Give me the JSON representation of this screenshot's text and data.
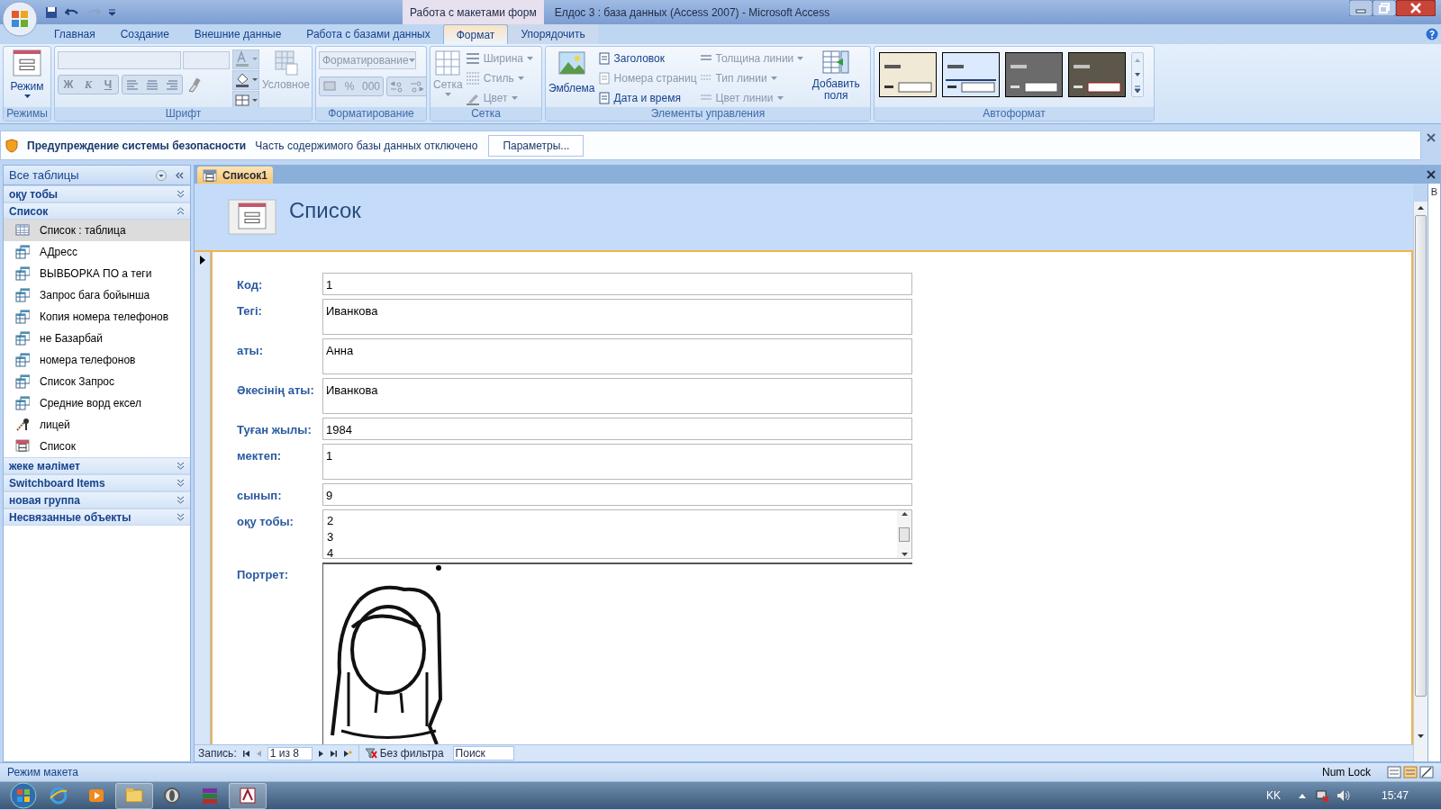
{
  "window": {
    "context": "Работа с макетами форм",
    "title": "Елдос 3 : база данных (Access 2007)  -  Microsoft Access"
  },
  "ribbon_tabs": [
    {
      "label": "Главная",
      "selected": false
    },
    {
      "label": "Создание",
      "selected": false
    },
    {
      "label": "Внешние данные",
      "selected": false
    },
    {
      "label": "Работа с базами данных",
      "selected": false
    },
    {
      "label": "Формат",
      "selected": true
    },
    {
      "label": "Упорядочить",
      "selected": false
    }
  ],
  "ribbon": {
    "modes": {
      "button": "Режим",
      "group": "Режимы"
    },
    "font": {
      "styles": [
        "Ж",
        "К",
        "Ч"
      ],
      "conditional": "Условное",
      "group": "Шрифт"
    },
    "formatting": {
      "dropdown": "Форматирование",
      "percent": "%",
      "thousands": "000",
      "group": "Форматирование"
    },
    "grid": {
      "button": "Сетка",
      "items": [
        {
          "label": "Ширина",
          "disabled": true
        },
        {
          "label": "Стиль",
          "disabled": true
        },
        {
          "label": "Цвет",
          "disabled": true
        }
      ],
      "group": "Сетка"
    },
    "controls": {
      "logo": "Эмблема",
      "items": [
        {
          "label": "Заголовок",
          "disabled": false
        },
        {
          "label": "Номера страниц",
          "disabled": true
        },
        {
          "label": "Дата и время",
          "disabled": false
        },
        {
          "label": "Толщина линии",
          "disabled": true
        },
        {
          "label": "Тип линии",
          "disabled": true
        },
        {
          "label": "Цвет линии",
          "disabled": true
        }
      ],
      "add_fields": "Добавить поля",
      "group": "Элементы управления"
    },
    "autoformat": {
      "styles": [
        {
          "color": "#efe9d6",
          "selected": false
        },
        {
          "color": "#dbeafe",
          "selected": false
        },
        {
          "color": "#6b6b6b",
          "selected": false
        },
        {
          "color": "#5c574a",
          "selected": false
        }
      ],
      "group": "Автоформат"
    }
  },
  "security_bar": {
    "title": "Предупреждение системы безопасности",
    "message": "Часть содержимого базы данных отключено",
    "button": "Параметры..."
  },
  "nav": {
    "title": "Все таблицы",
    "groups": [
      {
        "label": "оқу тобы",
        "expanded": false
      },
      {
        "label": "Список",
        "expanded": true,
        "items": [
          {
            "label": "Список : таблица",
            "kind": "table",
            "selected": true
          },
          {
            "label": "АДресс",
            "kind": "query",
            "selected": false
          },
          {
            "label": "ВЫВБОРКА  ПО а теги",
            "kind": "query",
            "selected": false
          },
          {
            "label": "Запрос бага бойынша",
            "kind": "query",
            "selected": false
          },
          {
            "label": "Копия номера телефонов",
            "kind": "query",
            "selected": false
          },
          {
            "label": "не Базарбай",
            "kind": "query",
            "selected": false
          },
          {
            "label": "номера телефонов",
            "kind": "query",
            "selected": false
          },
          {
            "label": "Список Запрос",
            "kind": "query",
            "selected": false
          },
          {
            "label": "Средние ворд ексел",
            "kind": "query",
            "selected": false
          },
          {
            "label": "лицей",
            "kind": "macro",
            "selected": false
          },
          {
            "label": "Список",
            "kind": "form",
            "selected": false
          }
        ]
      },
      {
        "label": "жеке мәлімет",
        "expanded": false
      },
      {
        "label": "Switchboard Items",
        "expanded": false
      },
      {
        "label": "новая группа",
        "expanded": false
      },
      {
        "label": "Несвязанные объекты",
        "expanded": false
      }
    ]
  },
  "document": {
    "tab": "Список1",
    "form_title": "Список",
    "side_pane": "В",
    "fields": [
      {
        "label": "Код:",
        "kind": "text",
        "value": "1"
      },
      {
        "label": "Тегі:",
        "kind": "memo",
        "value": "Иванкова"
      },
      {
        "label": "аты:",
        "kind": "memo",
        "value": "Анна"
      },
      {
        "label": "Әкесінің аты:",
        "kind": "memo",
        "value": "Иванкова"
      },
      {
        "label": "Туған жылы:",
        "kind": "text",
        "value": "1984"
      },
      {
        "label": "мектеп:",
        "kind": "memo",
        "value": "1"
      },
      {
        "label": "сынып:",
        "kind": "text",
        "value": "9"
      },
      {
        "label": "оқу тобы:",
        "kind": "list",
        "values": [
          "2",
          "3",
          "4"
        ]
      },
      {
        "label": "Портрет:",
        "kind": "picture"
      }
    ]
  },
  "record_nav": {
    "label": "Запись:",
    "position": "1 из 8",
    "filter": "Без фильтра",
    "search": "Поиск"
  },
  "status_bar": {
    "mode": "Режим макета",
    "num_lock": "Num Lock"
  },
  "taskbar": {
    "language": "KK",
    "time": "15:47"
  }
}
